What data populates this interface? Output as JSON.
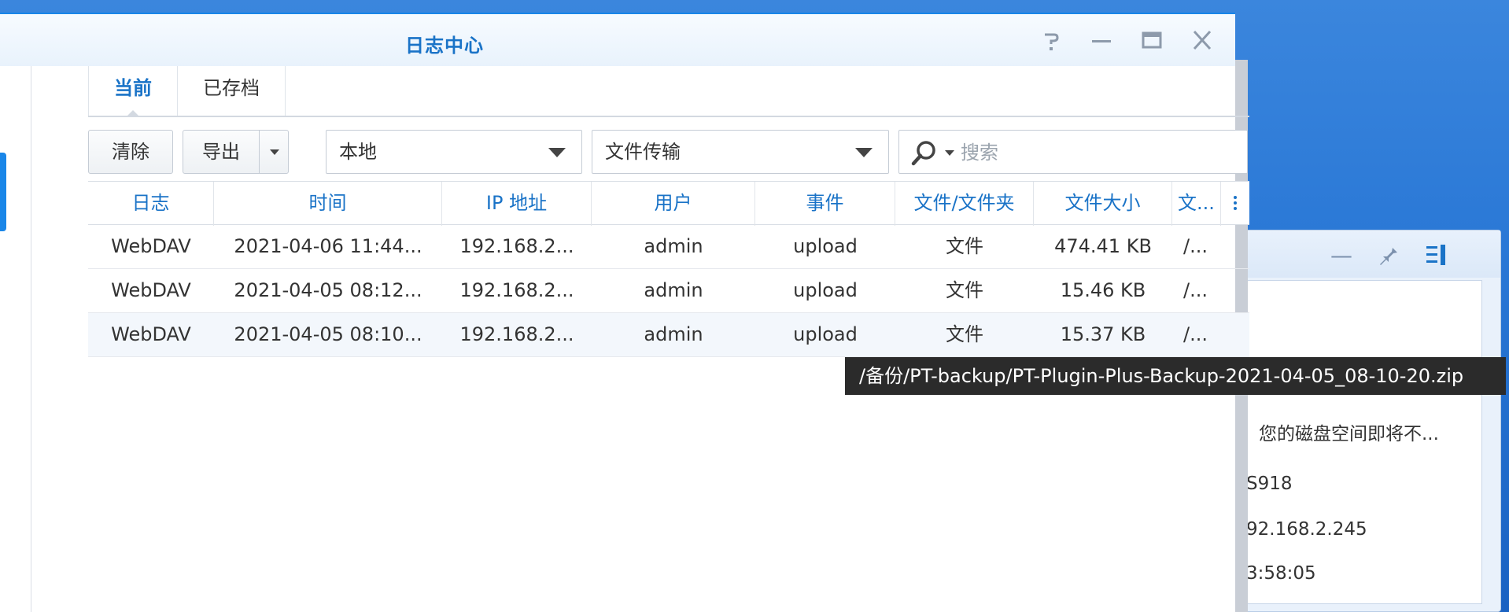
{
  "window": {
    "title": "日志中心",
    "controls": {
      "help_icon": "help-icon",
      "minimize_icon": "minimize-icon",
      "maximize_icon": "maximize-icon",
      "close_icon": "close-icon"
    }
  },
  "tabs": [
    {
      "label": "当前",
      "active": true
    },
    {
      "label": "已存档",
      "active": false
    }
  ],
  "toolbar": {
    "clear_label": "清除",
    "export_label": "导出",
    "location_select": "本地",
    "log_type_select": "文件传输",
    "search_placeholder": "搜索"
  },
  "table": {
    "columns": [
      "日志",
      "时间",
      "IP 地址",
      "用户",
      "事件",
      "文件/文件夹",
      "文件大小",
      "文..."
    ],
    "rows": [
      [
        "WebDAV",
        "2021-04-06 11:44...",
        "192.168.2...",
        "admin",
        "upload",
        "文件",
        "474.41 KB",
        "/..."
      ],
      [
        "WebDAV",
        "2021-04-05 08:12...",
        "192.168.2...",
        "admin",
        "upload",
        "文件",
        "15.46 KB",
        "/..."
      ],
      [
        "WebDAV",
        "2021-04-05 08:10...",
        "192.168.2...",
        "admin",
        "upload",
        "文件",
        "15.37 KB",
        "/..."
      ]
    ]
  },
  "tooltip": "/备份/PT-backup/PT-Plugin-Plus-Backup-2021-04-05_08-10-20.zip",
  "background_window": {
    "message": "您的磁盘空间即将不...",
    "host": "S918",
    "ip": "92.168.2.245",
    "time": "3:58:05"
  },
  "colors": {
    "accent": "#1a73c7",
    "desktop": "#2a78d6",
    "tooltip_bg": "#2b2b2b"
  }
}
